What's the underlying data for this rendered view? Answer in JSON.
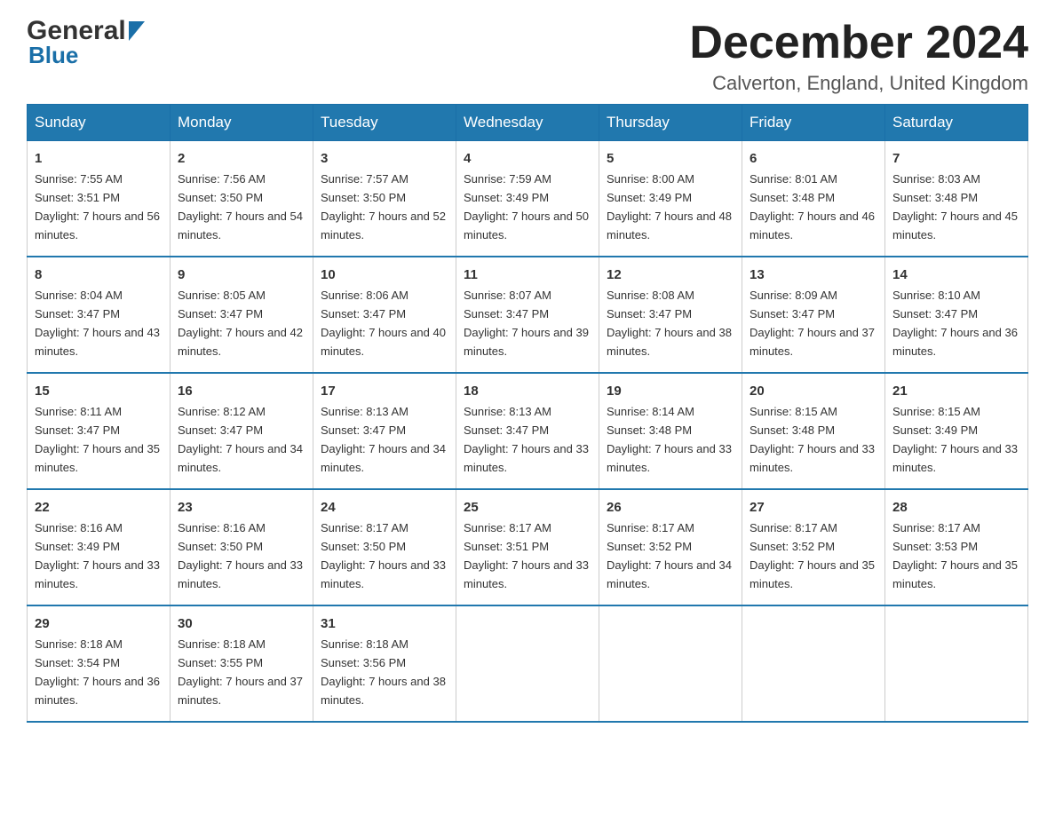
{
  "header": {
    "logo_general": "General",
    "logo_blue": "Blue",
    "month_title": "December 2024",
    "location": "Calverton, England, United Kingdom"
  },
  "days_of_week": [
    "Sunday",
    "Monday",
    "Tuesday",
    "Wednesday",
    "Thursday",
    "Friday",
    "Saturday"
  ],
  "weeks": [
    [
      {
        "day": "1",
        "sunrise": "Sunrise: 7:55 AM",
        "sunset": "Sunset: 3:51 PM",
        "daylight": "Daylight: 7 hours and 56 minutes."
      },
      {
        "day": "2",
        "sunrise": "Sunrise: 7:56 AM",
        "sunset": "Sunset: 3:50 PM",
        "daylight": "Daylight: 7 hours and 54 minutes."
      },
      {
        "day": "3",
        "sunrise": "Sunrise: 7:57 AM",
        "sunset": "Sunset: 3:50 PM",
        "daylight": "Daylight: 7 hours and 52 minutes."
      },
      {
        "day": "4",
        "sunrise": "Sunrise: 7:59 AM",
        "sunset": "Sunset: 3:49 PM",
        "daylight": "Daylight: 7 hours and 50 minutes."
      },
      {
        "day": "5",
        "sunrise": "Sunrise: 8:00 AM",
        "sunset": "Sunset: 3:49 PM",
        "daylight": "Daylight: 7 hours and 48 minutes."
      },
      {
        "day": "6",
        "sunrise": "Sunrise: 8:01 AM",
        "sunset": "Sunset: 3:48 PM",
        "daylight": "Daylight: 7 hours and 46 minutes."
      },
      {
        "day": "7",
        "sunrise": "Sunrise: 8:03 AM",
        "sunset": "Sunset: 3:48 PM",
        "daylight": "Daylight: 7 hours and 45 minutes."
      }
    ],
    [
      {
        "day": "8",
        "sunrise": "Sunrise: 8:04 AM",
        "sunset": "Sunset: 3:47 PM",
        "daylight": "Daylight: 7 hours and 43 minutes."
      },
      {
        "day": "9",
        "sunrise": "Sunrise: 8:05 AM",
        "sunset": "Sunset: 3:47 PM",
        "daylight": "Daylight: 7 hours and 42 minutes."
      },
      {
        "day": "10",
        "sunrise": "Sunrise: 8:06 AM",
        "sunset": "Sunset: 3:47 PM",
        "daylight": "Daylight: 7 hours and 40 minutes."
      },
      {
        "day": "11",
        "sunrise": "Sunrise: 8:07 AM",
        "sunset": "Sunset: 3:47 PM",
        "daylight": "Daylight: 7 hours and 39 minutes."
      },
      {
        "day": "12",
        "sunrise": "Sunrise: 8:08 AM",
        "sunset": "Sunset: 3:47 PM",
        "daylight": "Daylight: 7 hours and 38 minutes."
      },
      {
        "day": "13",
        "sunrise": "Sunrise: 8:09 AM",
        "sunset": "Sunset: 3:47 PM",
        "daylight": "Daylight: 7 hours and 37 minutes."
      },
      {
        "day": "14",
        "sunrise": "Sunrise: 8:10 AM",
        "sunset": "Sunset: 3:47 PM",
        "daylight": "Daylight: 7 hours and 36 minutes."
      }
    ],
    [
      {
        "day": "15",
        "sunrise": "Sunrise: 8:11 AM",
        "sunset": "Sunset: 3:47 PM",
        "daylight": "Daylight: 7 hours and 35 minutes."
      },
      {
        "day": "16",
        "sunrise": "Sunrise: 8:12 AM",
        "sunset": "Sunset: 3:47 PM",
        "daylight": "Daylight: 7 hours and 34 minutes."
      },
      {
        "day": "17",
        "sunrise": "Sunrise: 8:13 AM",
        "sunset": "Sunset: 3:47 PM",
        "daylight": "Daylight: 7 hours and 34 minutes."
      },
      {
        "day": "18",
        "sunrise": "Sunrise: 8:13 AM",
        "sunset": "Sunset: 3:47 PM",
        "daylight": "Daylight: 7 hours and 33 minutes."
      },
      {
        "day": "19",
        "sunrise": "Sunrise: 8:14 AM",
        "sunset": "Sunset: 3:48 PM",
        "daylight": "Daylight: 7 hours and 33 minutes."
      },
      {
        "day": "20",
        "sunrise": "Sunrise: 8:15 AM",
        "sunset": "Sunset: 3:48 PM",
        "daylight": "Daylight: 7 hours and 33 minutes."
      },
      {
        "day": "21",
        "sunrise": "Sunrise: 8:15 AM",
        "sunset": "Sunset: 3:49 PM",
        "daylight": "Daylight: 7 hours and 33 minutes."
      }
    ],
    [
      {
        "day": "22",
        "sunrise": "Sunrise: 8:16 AM",
        "sunset": "Sunset: 3:49 PM",
        "daylight": "Daylight: 7 hours and 33 minutes."
      },
      {
        "day": "23",
        "sunrise": "Sunrise: 8:16 AM",
        "sunset": "Sunset: 3:50 PM",
        "daylight": "Daylight: 7 hours and 33 minutes."
      },
      {
        "day": "24",
        "sunrise": "Sunrise: 8:17 AM",
        "sunset": "Sunset: 3:50 PM",
        "daylight": "Daylight: 7 hours and 33 minutes."
      },
      {
        "day": "25",
        "sunrise": "Sunrise: 8:17 AM",
        "sunset": "Sunset: 3:51 PM",
        "daylight": "Daylight: 7 hours and 33 minutes."
      },
      {
        "day": "26",
        "sunrise": "Sunrise: 8:17 AM",
        "sunset": "Sunset: 3:52 PM",
        "daylight": "Daylight: 7 hours and 34 minutes."
      },
      {
        "day": "27",
        "sunrise": "Sunrise: 8:17 AM",
        "sunset": "Sunset: 3:52 PM",
        "daylight": "Daylight: 7 hours and 35 minutes."
      },
      {
        "day": "28",
        "sunrise": "Sunrise: 8:17 AM",
        "sunset": "Sunset: 3:53 PM",
        "daylight": "Daylight: 7 hours and 35 minutes."
      }
    ],
    [
      {
        "day": "29",
        "sunrise": "Sunrise: 8:18 AM",
        "sunset": "Sunset: 3:54 PM",
        "daylight": "Daylight: 7 hours and 36 minutes."
      },
      {
        "day": "30",
        "sunrise": "Sunrise: 8:18 AM",
        "sunset": "Sunset: 3:55 PM",
        "daylight": "Daylight: 7 hours and 37 minutes."
      },
      {
        "day": "31",
        "sunrise": "Sunrise: 8:18 AM",
        "sunset": "Sunset: 3:56 PM",
        "daylight": "Daylight: 7 hours and 38 minutes."
      },
      null,
      null,
      null,
      null
    ]
  ]
}
